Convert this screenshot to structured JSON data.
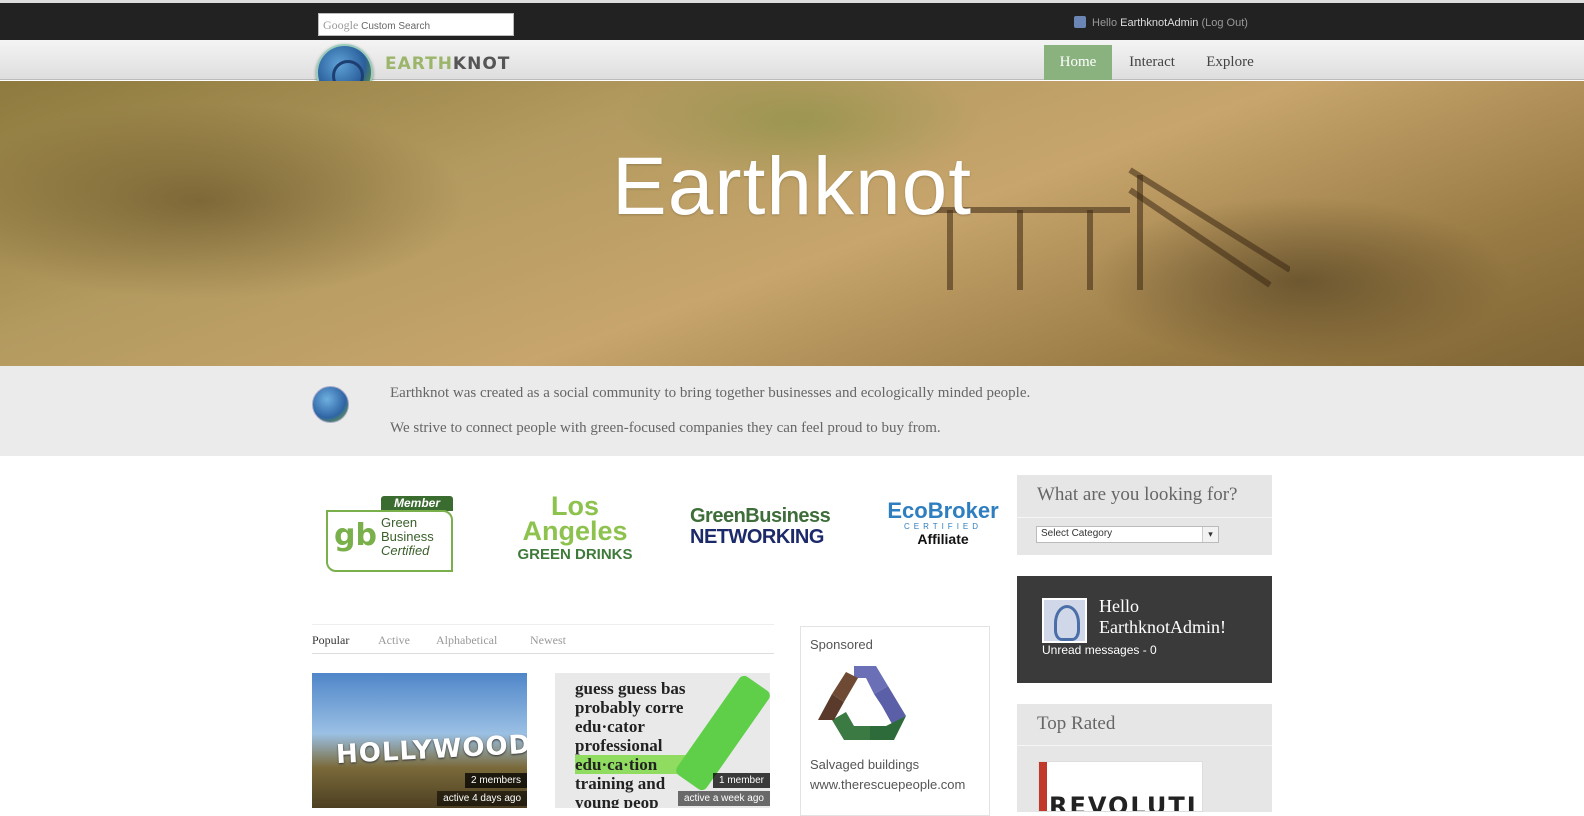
{
  "topbar": {
    "search_brand": "Google",
    "search_placeholder": "Custom Search",
    "hello_prefix": "Hello ",
    "username": "EarthknotAdmin",
    "logout": "(Log Out)"
  },
  "header": {
    "logo_text_a": "EARTH",
    "logo_text_b": "KNOT",
    "nav": [
      "Home",
      "Interact",
      "Explore"
    ],
    "active_nav": "Home"
  },
  "hero": {
    "title": "Earthknot"
  },
  "intro": {
    "line1": "Earthknot was created as a social community to bring together businesses and ecologically minded people.",
    "line2": "We strive to connect people with green-focused companies they can feel proud to buy from."
  },
  "badges": {
    "gbc": {
      "tag": "Member",
      "line1": "Green",
      "line2": "Business",
      "line3": "Certified",
      "mark": "gb"
    },
    "la": {
      "line1": "Los",
      "line2": "Angeles",
      "line3": "GREEN DRINKS"
    },
    "gbn": {
      "line1": "GreenBusiness",
      "line2": "NETWORKING"
    },
    "eco": {
      "line1": "EcoBroker",
      "line2": "CERTIFIED",
      "line3": "Affiliate"
    }
  },
  "tabs": [
    "Popular",
    "Active",
    "Alphabetical",
    "Newest"
  ],
  "groups": [
    {
      "image_text": "HOLLYWOOD",
      "members": "2 members",
      "activity": "active 4 days ago"
    },
    {
      "image_text": [
        "guess guess bas",
        "probably corre",
        "edu·cator",
        "professional",
        "edu·ca·tion",
        "training and",
        "young peop"
      ],
      "members": "1 member",
      "activity": "active a week ago"
    }
  ],
  "sponsored": {
    "heading": "Sponsored",
    "text": "Salvaged buildings",
    "url": "www.therescuepeople.com"
  },
  "sidebar": {
    "search_title": "What are you looking for?",
    "select_value": "Select Category",
    "hello_line1": "Hello",
    "hello_line2": "EarthknotAdmin!",
    "unread": "Unread messages - 0",
    "top_rated_title": "Top Rated",
    "top_rated_image_text": "REVOLUTI"
  },
  "colors": {
    "nav_active": "#8ab27f",
    "topbar": "#222222",
    "hello_widget": "#3a3a3a"
  }
}
